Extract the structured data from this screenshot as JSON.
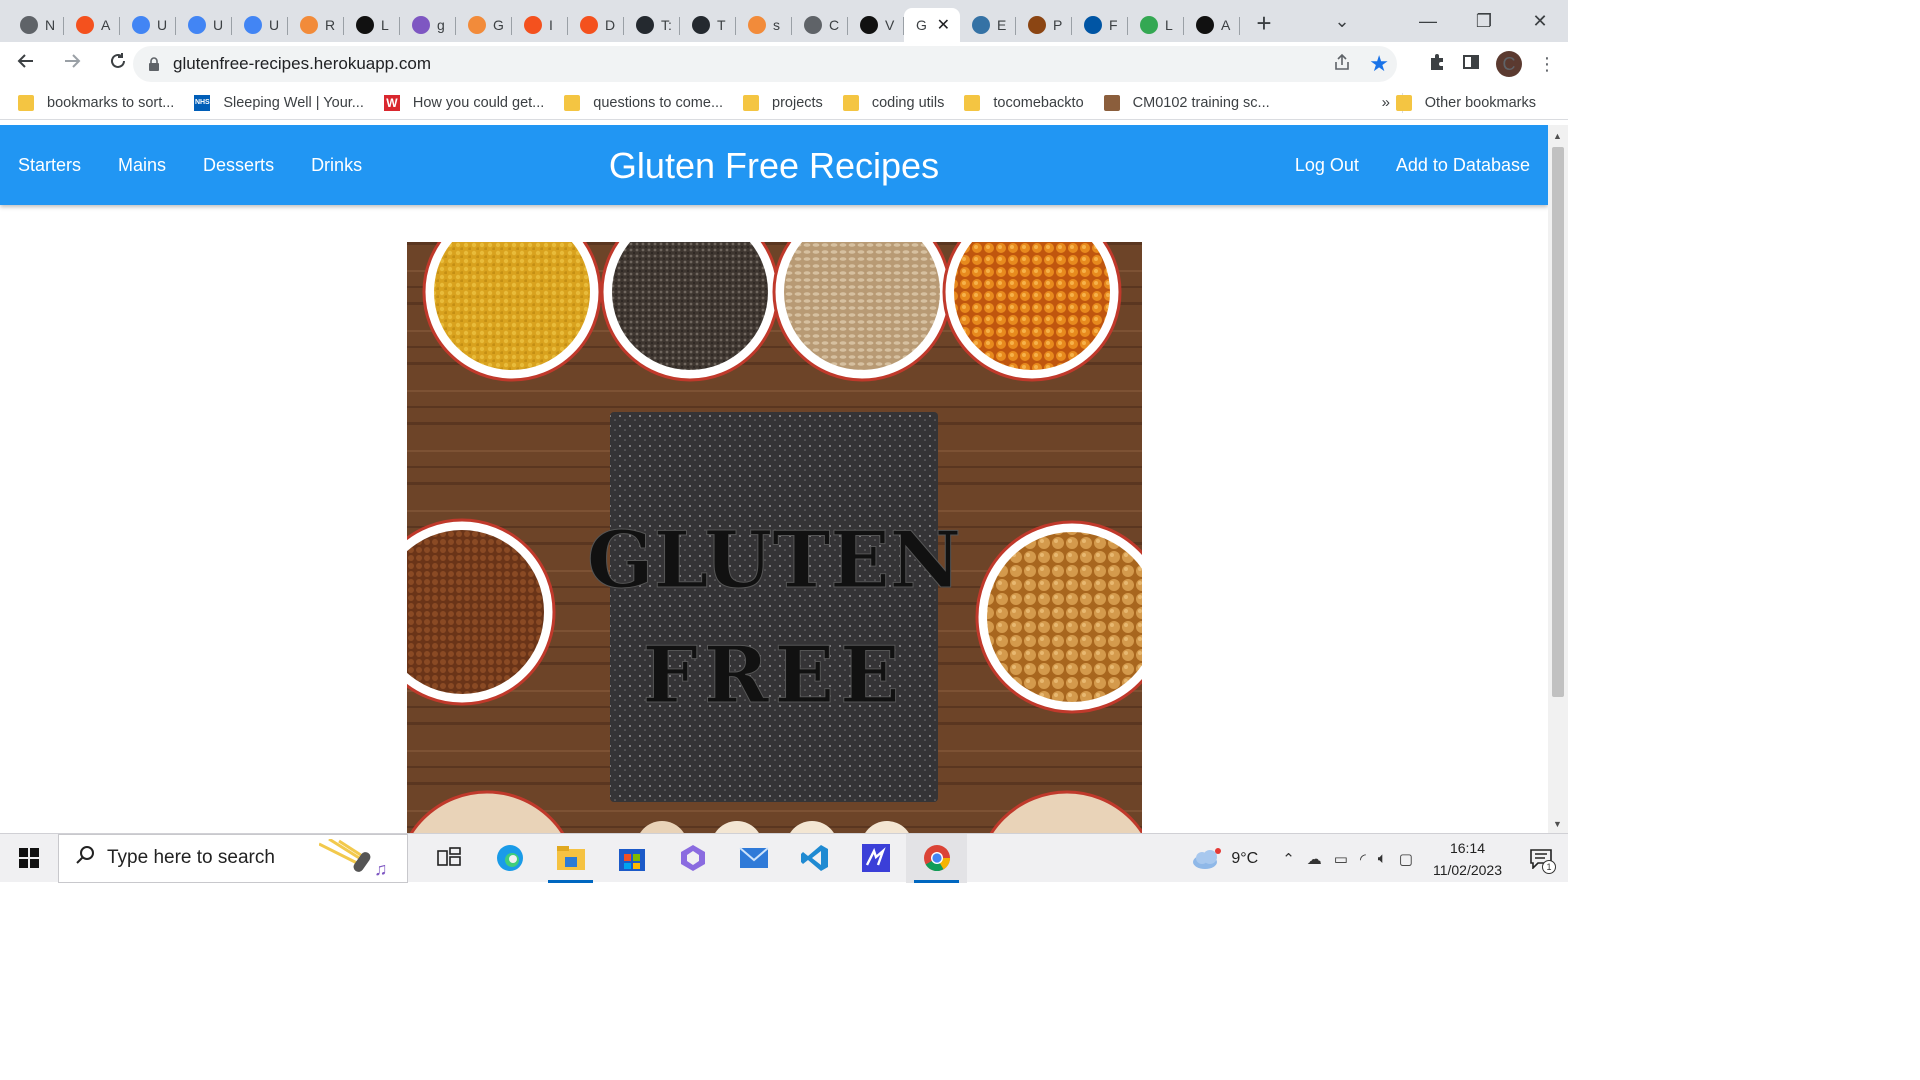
{
  "browser": {
    "tabs": [
      {
        "letter": "N",
        "icon": "chrome-icon",
        "color": "#5f6368"
      },
      {
        "letter": "A",
        "icon": "circle-icon",
        "color": "#f4511e"
      },
      {
        "letter": "U",
        "icon": "docs-icon",
        "color": "#4285f4"
      },
      {
        "letter": "U",
        "icon": "docs-icon",
        "color": "#4285f4"
      },
      {
        "letter": "U",
        "icon": "docs-icon",
        "color": "#4285f4"
      },
      {
        "letter": "R",
        "icon": "g-icon",
        "color": "#f28b3a"
      },
      {
        "letter": "L",
        "icon": "leaf-icon",
        "color": "#111111"
      },
      {
        "letter": "g",
        "icon": "h-icon",
        "color": "#7e57c2"
      },
      {
        "letter": "G",
        "icon": "g-icon",
        "color": "#f28b3a"
      },
      {
        "letter": "I",
        "icon": "circle-icon",
        "color": "#f4511e"
      },
      {
        "letter": "D",
        "icon": "circle-icon",
        "color": "#f4511e"
      },
      {
        "letter": "T:",
        "icon": "github-icon",
        "color": "#24292f"
      },
      {
        "letter": "T",
        "icon": "github-icon",
        "color": "#24292f"
      },
      {
        "letter": "s",
        "icon": "g-icon",
        "color": "#f28b3a"
      },
      {
        "letter": "C",
        "icon": "globe-icon",
        "color": "#5f6368"
      },
      {
        "letter": "V",
        "icon": "square-icon",
        "color": "#111111"
      },
      {
        "letter": "G",
        "icon": "none",
        "color": "#ffffff",
        "active": true
      },
      {
        "letter": "E",
        "icon": "python-icon",
        "color": "#3572a5"
      },
      {
        "letter": "P",
        "icon": "box-icon",
        "color": "#8b4513"
      },
      {
        "letter": "F",
        "icon": "flag-icon",
        "color": "#0055a4"
      },
      {
        "letter": "L",
        "icon": "chrome-icon",
        "color": "#34a853"
      },
      {
        "letter": "A",
        "icon": "u-icon",
        "color": "#111111"
      }
    ],
    "new_tab": "+",
    "window_controls": {
      "chevron": "⌄",
      "minimize": "—",
      "restore": "❐",
      "close": "✕"
    },
    "url": "glutenfree-recipes.herokuapp.com",
    "avatar_letter": "C",
    "bookmarks": [
      {
        "label": "bookmarks to sort...",
        "icon": "folder"
      },
      {
        "label": "Sleeping Well | Your...",
        "icon": "nhs"
      },
      {
        "label": "How you could get...",
        "icon": "w"
      },
      {
        "label": "questions to come...",
        "icon": "folder"
      },
      {
        "label": "projects",
        "icon": "folder"
      },
      {
        "label": "coding utils",
        "icon": "folder"
      },
      {
        "label": "tocomebackto",
        "icon": "folder"
      },
      {
        "label": "CM0102 training sc...",
        "icon": "cm"
      }
    ],
    "bookmarks_more": "»",
    "other_bookmarks": "Other bookmarks"
  },
  "site": {
    "nav_left": [
      "Starters",
      "Mains",
      "Desserts",
      "Drinks"
    ],
    "brand": "Gluten Free Recipes",
    "nav_right": [
      "Log Out",
      "Add to Database"
    ],
    "hero_text_line1": "GLUTEN",
    "hero_text_line2": "FREE"
  },
  "taskbar": {
    "search_placeholder": "Type here to search",
    "weather": "9°C",
    "time": "16:14",
    "date": "11/02/2023",
    "notification_count": "1"
  },
  "colors": {
    "site_header": "#2196f3",
    "tabstrip": "#dee1e6",
    "taskbar": "#f0f0f2"
  }
}
